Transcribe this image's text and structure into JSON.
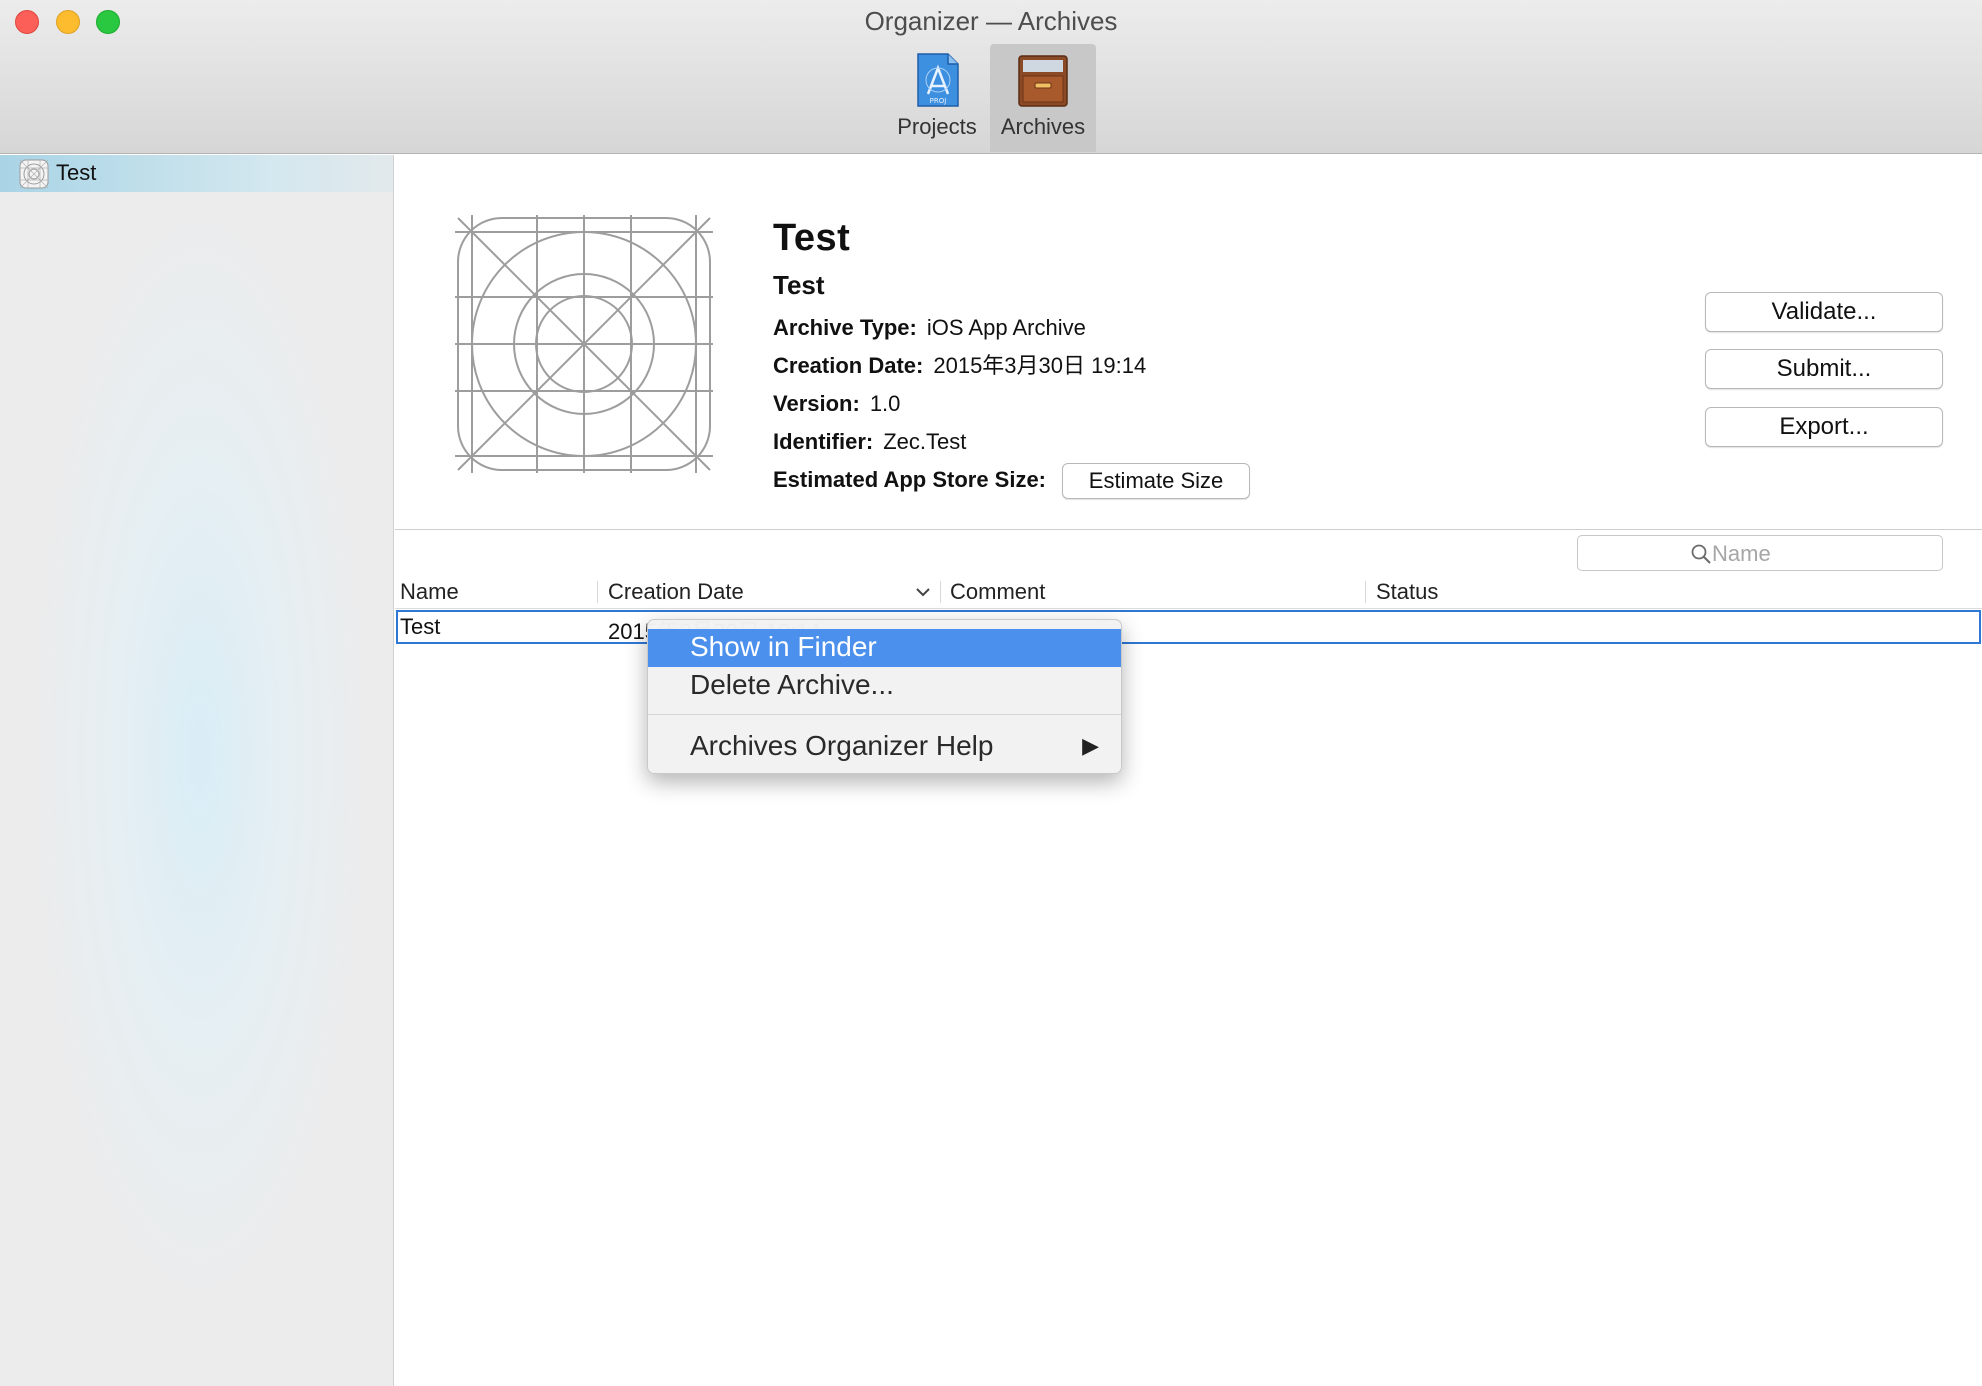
{
  "window": {
    "title": "Organizer — Archives",
    "traffic_lights": {
      "close": "#fc5f57",
      "minimize": "#fdbc2e",
      "maximize": "#29c840"
    }
  },
  "toolbar": {
    "items": [
      {
        "label": "Projects",
        "icon": "app-store-icon",
        "selected": false
      },
      {
        "label": "Archives",
        "icon": "archive-box-icon",
        "selected": true
      }
    ]
  },
  "sidebar": {
    "items": [
      {
        "label": "Test",
        "icon": "app-icon-grid",
        "selected": true
      }
    ]
  },
  "archive": {
    "app_name": "Test",
    "archive_name": "Test",
    "fields": [
      {
        "label": "Archive Type:",
        "value": "iOS App Archive"
      },
      {
        "label": "Creation Date:",
        "value": "2015年3月30日 19:14"
      },
      {
        "label": "Version:",
        "value": "1.0"
      },
      {
        "label": "Identifier:",
        "value": "Zec.Test"
      }
    ],
    "size_label": "Estimated App Store Size:",
    "estimate_button": "Estimate Size",
    "actions": {
      "validate": "Validate...",
      "submit": "Submit...",
      "export": "Export..."
    }
  },
  "search": {
    "placeholder": "Name",
    "icon": "search-icon"
  },
  "table": {
    "columns": [
      "Name",
      "Creation Date",
      "Comment",
      "Status"
    ],
    "sort_column": "Creation Date",
    "sort_direction": "descending",
    "rows": [
      {
        "name": "Test",
        "creation_date": "2015年3月30日 19:14",
        "comment": "",
        "status": "",
        "selected": true
      }
    ]
  },
  "context_menu": {
    "items": [
      {
        "label": "Show in Finder",
        "highlighted": true
      },
      {
        "label": "Delete Archive...",
        "highlighted": false
      },
      {
        "label": "Archives Organizer Help",
        "submenu": true,
        "highlighted": false
      }
    ],
    "highlight_color": "#4a90ec"
  },
  "colors": {
    "selection_border": "#2f77d4",
    "sidebar_selection": "#a9d4e6"
  }
}
